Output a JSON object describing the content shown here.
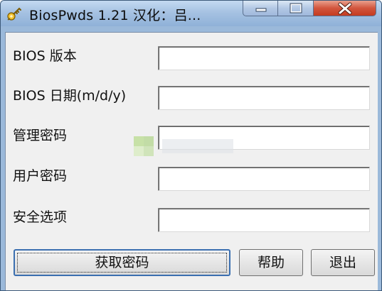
{
  "window": {
    "title": "BiosPwds 1.21  汉化：吕...",
    "icon": "key-icon",
    "controls": {
      "minimize": "minimize-icon",
      "maximize": "maximize-icon",
      "close": "close-icon"
    }
  },
  "form": {
    "fields": [
      {
        "label": "BIOS 版本",
        "value": ""
      },
      {
        "label": "BIOS 日期(m/d/y)",
        "value": ""
      },
      {
        "label": "管理密码",
        "value": ""
      },
      {
        "label": "用户密码",
        "value": ""
      },
      {
        "label": "安全选项",
        "value": ""
      }
    ]
  },
  "buttons": {
    "get_password": "获取密码",
    "help": "帮助",
    "exit": "退出"
  },
  "colors": {
    "titlebar": "#a6c2e2",
    "client_bg": "#f0f0f0",
    "close_button": "#c43b20"
  }
}
